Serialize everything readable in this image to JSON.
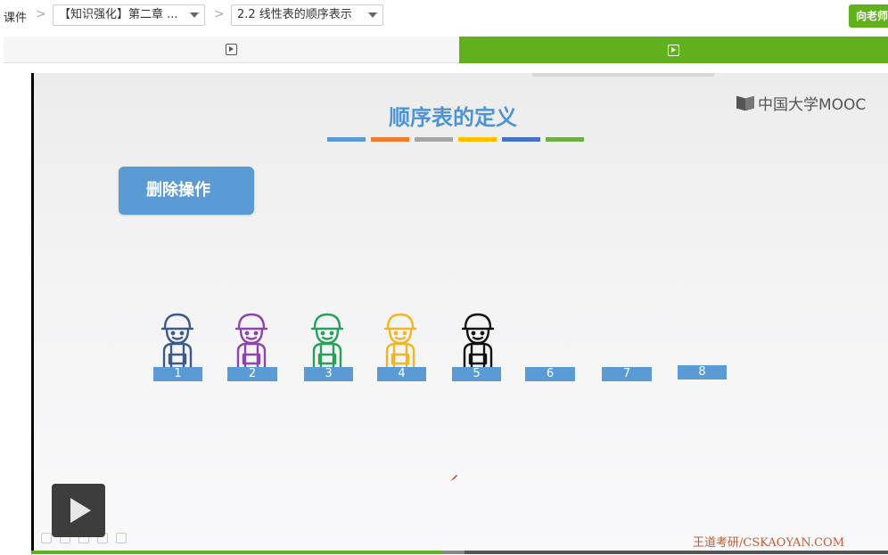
{
  "breadcrumb": {
    "root": "课件",
    "separator": ">",
    "course_select": "【知识强化】第二章 ...",
    "lesson_select": "2.2 线性表的顺序表示"
  },
  "ask_teacher_label": "向老师",
  "tabs": [
    {
      "icon": "play-square-icon",
      "active": false
    },
    {
      "icon": "play-square-icon",
      "active": true
    }
  ],
  "slide": {
    "logo_text": "中国大学MOOC",
    "title": "顺序表的定义",
    "color_lines": [
      "#5b9bd5",
      "#ed7d31",
      "#a5a5a5",
      "#ffc000",
      "#4472c4",
      "#70ad47"
    ],
    "operation_label": "删除操作",
    "slots": [
      "1",
      "2",
      "3",
      "4",
      "5",
      "6",
      "7",
      "8"
    ],
    "person_colors": [
      "#3c5a8c",
      "#8e44ad",
      "#27a05a",
      "#f2b523",
      "#111111"
    ],
    "brand_text": "王道考研/CSKAOYAN.COM"
  },
  "player": {
    "progress_fraction": 0.48,
    "accent": "#61b11f"
  }
}
